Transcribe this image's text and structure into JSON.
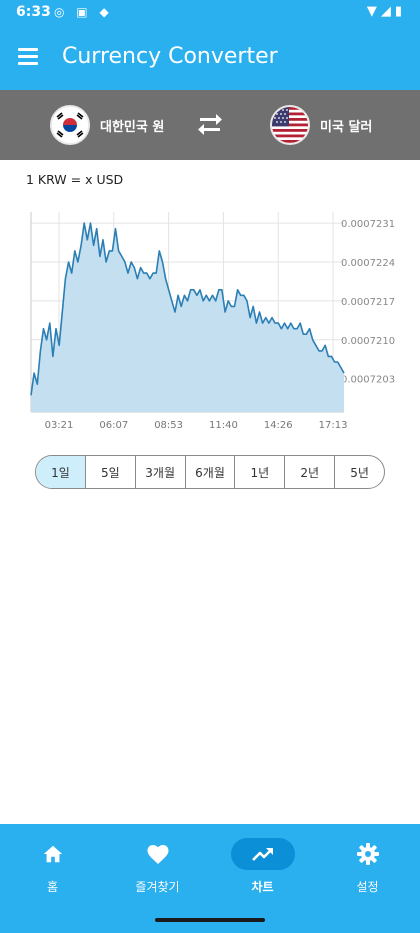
{
  "status_bar": {
    "time": "6:33"
  },
  "app_bar": {
    "title": "Currency Converter"
  },
  "converter": {
    "from_currency": {
      "label": "대한민국 원",
      "flag": "south-korea-flag"
    },
    "to_currency": {
      "label": "미국 달러",
      "flag": "usa-flag"
    },
    "rate_label": "1 KRW = x USD"
  },
  "chart_data": {
    "type": "area",
    "x_ticks": [
      "03:21",
      "06:07",
      "08:53",
      "11:40",
      "14:26",
      "17:13"
    ],
    "y_ticks": [
      "0.0007203",
      "0.0007210",
      "0.0007217",
      "0.0007224",
      "0.0007231"
    ],
    "ylim": [
      0.0007197,
      0.0007233
    ],
    "grid": true,
    "color": "#2b7fb4",
    "fill": "#c4dfef",
    "points": [
      [
        0.0,
        0.00072
      ],
      [
        0.01,
        0.0007204
      ],
      [
        0.02,
        0.0007202
      ],
      [
        0.03,
        0.0007208
      ],
      [
        0.04,
        0.0007212
      ],
      [
        0.05,
        0.000721
      ],
      [
        0.06,
        0.0007213
      ],
      [
        0.07,
        0.0007207
      ],
      [
        0.08,
        0.0007212
      ],
      [
        0.09,
        0.0007209
      ],
      [
        0.1,
        0.0007215
      ],
      [
        0.11,
        0.0007221
      ],
      [
        0.12,
        0.0007224
      ],
      [
        0.13,
        0.0007222
      ],
      [
        0.14,
        0.0007226
      ],
      [
        0.15,
        0.0007224
      ],
      [
        0.16,
        0.0007227
      ],
      [
        0.17,
        0.0007231
      ],
      [
        0.18,
        0.0007228
      ],
      [
        0.19,
        0.0007231
      ],
      [
        0.2,
        0.0007227
      ],
      [
        0.21,
        0.000723
      ],
      [
        0.22,
        0.0007225
      ],
      [
        0.23,
        0.0007228
      ],
      [
        0.24,
        0.0007224
      ],
      [
        0.25,
        0.0007226
      ],
      [
        0.26,
        0.0007226
      ],
      [
        0.27,
        0.000723
      ],
      [
        0.28,
        0.0007226
      ],
      [
        0.29,
        0.0007225
      ],
      [
        0.3,
        0.0007224
      ],
      [
        0.31,
        0.0007222
      ],
      [
        0.32,
        0.0007224
      ],
      [
        0.33,
        0.0007223
      ],
      [
        0.34,
        0.0007221
      ],
      [
        0.35,
        0.0007223
      ],
      [
        0.36,
        0.0007222
      ],
      [
        0.37,
        0.0007222
      ],
      [
        0.38,
        0.0007221
      ],
      [
        0.39,
        0.0007222
      ],
      [
        0.4,
        0.0007222
      ],
      [
        0.41,
        0.0007226
      ],
      [
        0.42,
        0.0007224
      ],
      [
        0.43,
        0.0007221
      ],
      [
        0.44,
        0.0007219
      ],
      [
        0.45,
        0.0007217
      ],
      [
        0.46,
        0.0007215
      ],
      [
        0.47,
        0.0007218
      ],
      [
        0.48,
        0.0007216
      ],
      [
        0.49,
        0.0007218
      ],
      [
        0.5,
        0.0007217
      ],
      [
        0.51,
        0.0007219
      ],
      [
        0.52,
        0.0007219
      ],
      [
        0.53,
        0.0007218
      ],
      [
        0.54,
        0.0007219
      ],
      [
        0.55,
        0.0007217
      ],
      [
        0.56,
        0.0007218
      ],
      [
        0.57,
        0.0007217
      ],
      [
        0.58,
        0.0007218
      ],
      [
        0.59,
        0.0007217
      ],
      [
        0.6,
        0.0007219
      ],
      [
        0.61,
        0.0007219
      ],
      [
        0.62,
        0.0007215
      ],
      [
        0.63,
        0.0007217
      ],
      [
        0.64,
        0.0007216
      ],
      [
        0.65,
        0.0007216
      ],
      [
        0.66,
        0.0007219
      ],
      [
        0.67,
        0.0007218
      ],
      [
        0.68,
        0.0007218
      ],
      [
        0.69,
        0.0007217
      ],
      [
        0.7,
        0.0007214
      ],
      [
        0.71,
        0.0007216
      ],
      [
        0.72,
        0.0007213
      ],
      [
        0.73,
        0.0007215
      ],
      [
        0.74,
        0.0007213
      ],
      [
        0.75,
        0.0007214
      ],
      [
        0.76,
        0.0007213
      ],
      [
        0.77,
        0.0007214
      ],
      [
        0.78,
        0.0007213
      ],
      [
        0.79,
        0.0007213
      ],
      [
        0.8,
        0.0007212
      ],
      [
        0.81,
        0.0007213
      ],
      [
        0.82,
        0.0007212
      ],
      [
        0.83,
        0.0007213
      ],
      [
        0.84,
        0.0007212
      ],
      [
        0.85,
        0.0007212
      ],
      [
        0.86,
        0.0007213
      ],
      [
        0.87,
        0.0007211
      ],
      [
        0.88,
        0.0007211
      ],
      [
        0.89,
        0.0007212
      ],
      [
        0.9,
        0.000721
      ],
      [
        0.91,
        0.0007209
      ],
      [
        0.92,
        0.0007208
      ],
      [
        0.93,
        0.0007208
      ],
      [
        0.94,
        0.0007209
      ],
      [
        0.95,
        0.0007207
      ],
      [
        0.96,
        0.0007207
      ],
      [
        0.97,
        0.0007206
      ],
      [
        0.98,
        0.0007206
      ],
      [
        0.99,
        0.0007205
      ],
      [
        1.0,
        0.0007204
      ]
    ]
  },
  "ranges": [
    {
      "label": "1일",
      "active": true
    },
    {
      "label": "5일",
      "active": false
    },
    {
      "label": "3개월",
      "active": false
    },
    {
      "label": "6개월",
      "active": false
    },
    {
      "label": "1년",
      "active": false
    },
    {
      "label": "2년",
      "active": false
    },
    {
      "label": "5년",
      "active": false
    }
  ],
  "nav": [
    {
      "label": "홈",
      "icon": "home-icon",
      "active": false
    },
    {
      "label": "즐겨찾기",
      "icon": "heart-icon",
      "active": false
    },
    {
      "label": "차트",
      "icon": "trending-up-icon",
      "active": true
    },
    {
      "label": "설정",
      "icon": "gear-icon",
      "active": false
    }
  ]
}
